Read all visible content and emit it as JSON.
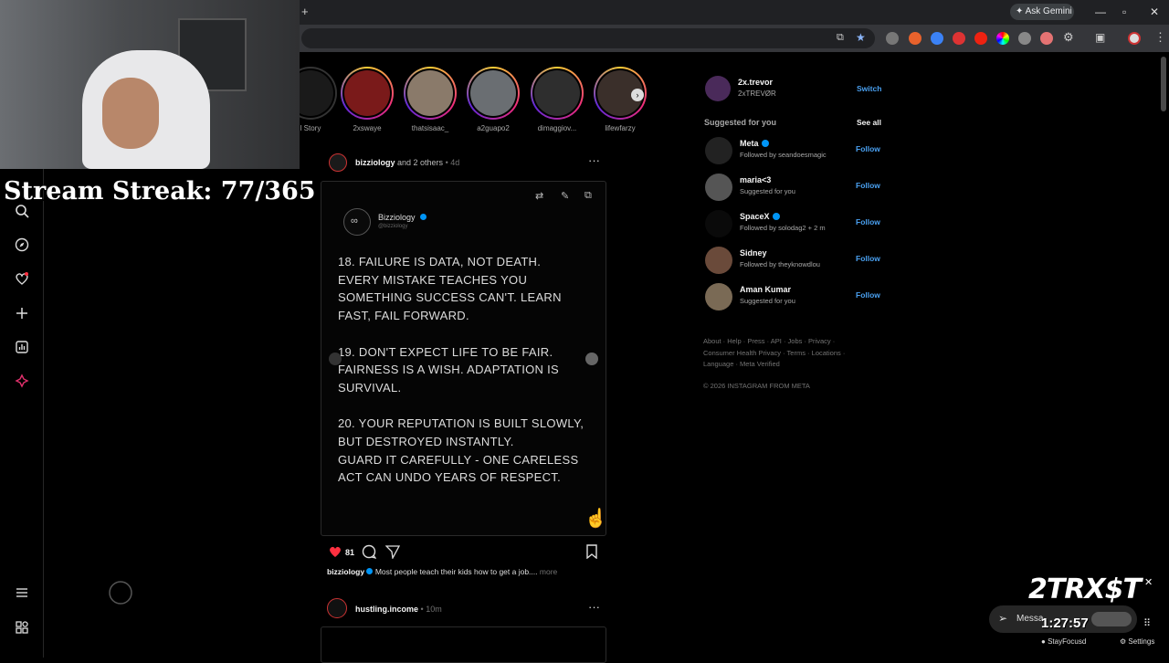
{
  "browser": {
    "ask_gemini": "Ask Gemini",
    "new_tab": "+"
  },
  "overlay": {
    "stream_streak": "Stream Streak: 77/365",
    "logo": "2TRX$T",
    "timer": "1:27:57",
    "stayfocusd": "StayFocusd",
    "settings": "Settings",
    "messages": "Messa",
    "close": "✕"
  },
  "stories": [
    {
      "name": "l Story",
      "color": "#1a1a1a"
    },
    {
      "name": "2xswaye",
      "color": "#7a1a1a"
    },
    {
      "name": "thatsisaac_",
      "color": "#8a7a6a"
    },
    {
      "name": "a2guapo2",
      "color": "#6a6e72"
    },
    {
      "name": "dimaggiov...",
      "color": "#2e2e2e"
    },
    {
      "name": "lifewfarzy",
      "color": "#3a2f2a"
    }
  ],
  "post": {
    "author": "bizziology",
    "and_others": "and 2 others",
    "age": "4d",
    "card_author": "Bizziology",
    "card_handle": "@bizziology",
    "text": "18. FAILURE IS DATA, NOT DEATH.\nEVERY MISTAKE TEACHES YOU\nSOMETHING SUCCESS CAN'T. LEARN\nFAST, FAIL FORWARD.\n\n19. DON'T EXPECT LIFE TO BE FAIR.\nFAIRNESS IS A WISH. ADAPTATION IS\nSURVIVAL.\n\n20. YOUR REPUTATION IS BUILT SLOWLY,\nBUT DESTROYED INSTANTLY.\nGUARD IT CAREFULLY - ONE CARELESS\nACT CAN UNDO YEARS OF RESPECT.",
    "likes": "81",
    "caption_user": "bizziology",
    "caption_text": "Most people teach their kids how to get a job....",
    "more": "more"
  },
  "next_post": {
    "author": "hustling.income",
    "age": "10m"
  },
  "account": {
    "username": "2x.trevor",
    "fullname": "2xTREVØR",
    "switch": "Switch"
  },
  "suggested": {
    "heading": "Suggested for you",
    "see_all": "See all",
    "follow_label": "Follow",
    "items": [
      {
        "name": "Meta",
        "verified": true,
        "sub": "Followed by seandoesmagic",
        "color": "#222"
      },
      {
        "name": "maria<3",
        "verified": false,
        "sub": "Suggested for you",
        "color": "#555"
      },
      {
        "name": "SpaceX",
        "verified": true,
        "sub": "Followed by solodag2 + 2 m",
        "color": "#0a0a0a"
      },
      {
        "name": "Sidney",
        "verified": false,
        "sub": "Followed by theyknowdlou",
        "color": "#6a4a3a"
      },
      {
        "name": "Aman Kumar",
        "verified": false,
        "sub": "Suggested for you",
        "color": "#7a6a55"
      }
    ]
  },
  "footer": {
    "links": "About · Help · Press · API · Jobs · Privacy · Consumer Health Privacy · Terms · Locations · Language · Meta Verified",
    "copyright": "© 2026 INSTAGRAM FROM META"
  }
}
